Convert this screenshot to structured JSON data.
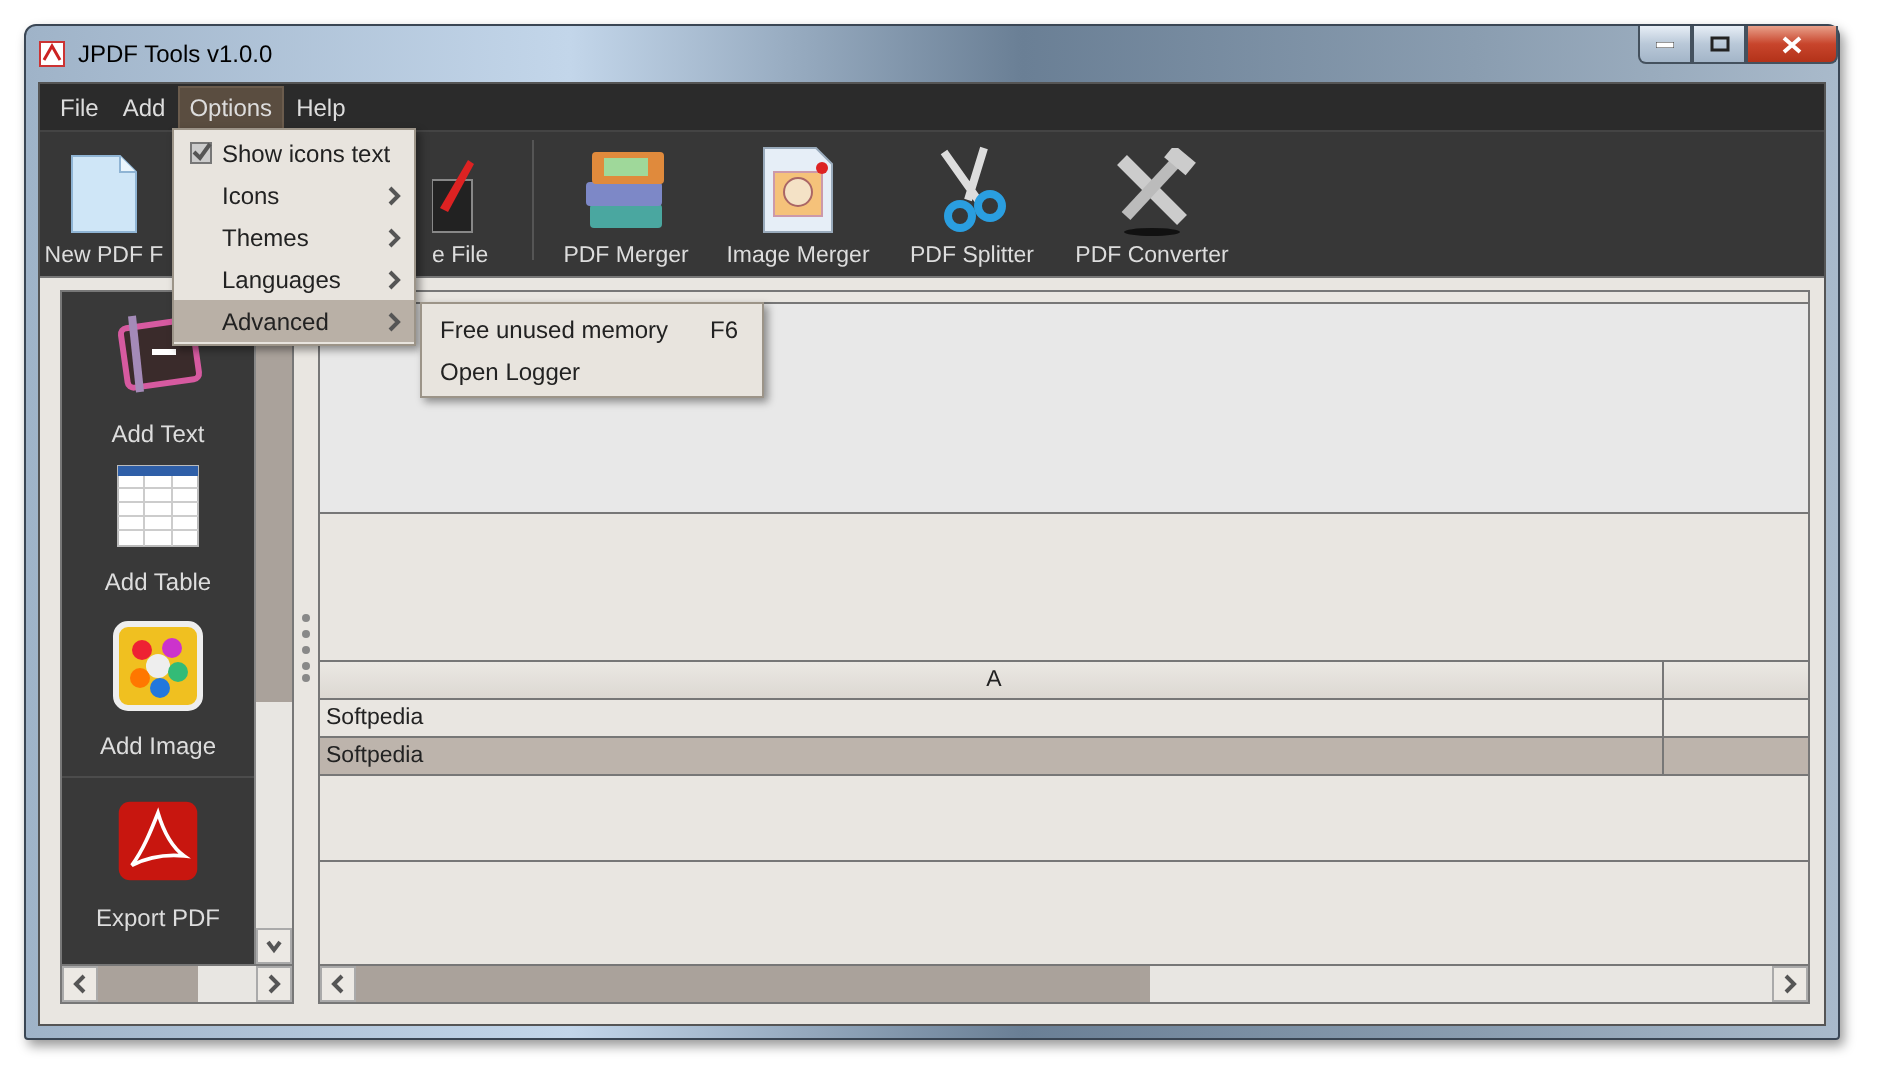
{
  "window": {
    "title": "JPDF Tools v1.0.0"
  },
  "menu_bar": [
    {
      "label": "File",
      "selected": false
    },
    {
      "label": "Add",
      "selected": false
    },
    {
      "label": "Options",
      "selected": true
    },
    {
      "label": "Help",
      "selected": false
    }
  ],
  "options_menu": [
    {
      "label": "Show icons text",
      "kind": "check",
      "checked": true,
      "selected": false
    },
    {
      "label": "Icons",
      "kind": "submenu",
      "selected": false
    },
    {
      "label": "Themes",
      "kind": "submenu",
      "selected": false
    },
    {
      "label": "Languages",
      "kind": "submenu",
      "selected": false
    },
    {
      "label": "Advanced",
      "kind": "submenu",
      "selected": true
    }
  ],
  "advanced_submenu": [
    {
      "label": "Free unused memory",
      "shortcut": "F6"
    },
    {
      "label": "Open Logger"
    }
  ],
  "toolbar": [
    {
      "label": "New PDF F",
      "kind": "page"
    },
    {
      "label": "e File",
      "kind": "save"
    },
    {
      "label": "PDF Merger",
      "kind": "books"
    },
    {
      "label": "Image Merger",
      "kind": "picture"
    },
    {
      "label": "PDF Splitter",
      "kind": "scissors"
    },
    {
      "label": "PDF Converter",
      "kind": "tools"
    }
  ],
  "side_panel": [
    {
      "label": "Add Text",
      "kind": "text"
    },
    {
      "label": "Add Table",
      "kind": "table"
    },
    {
      "label": "Add Image",
      "kind": "image"
    },
    {
      "label": "Export PDF",
      "kind": "pdf"
    }
  ],
  "table": {
    "columns": [
      "A"
    ],
    "rows": [
      {
        "cells": [
          "Softpedia"
        ],
        "selected": false
      },
      {
        "cells": [
          "Softpedia"
        ],
        "selected": true
      }
    ]
  }
}
